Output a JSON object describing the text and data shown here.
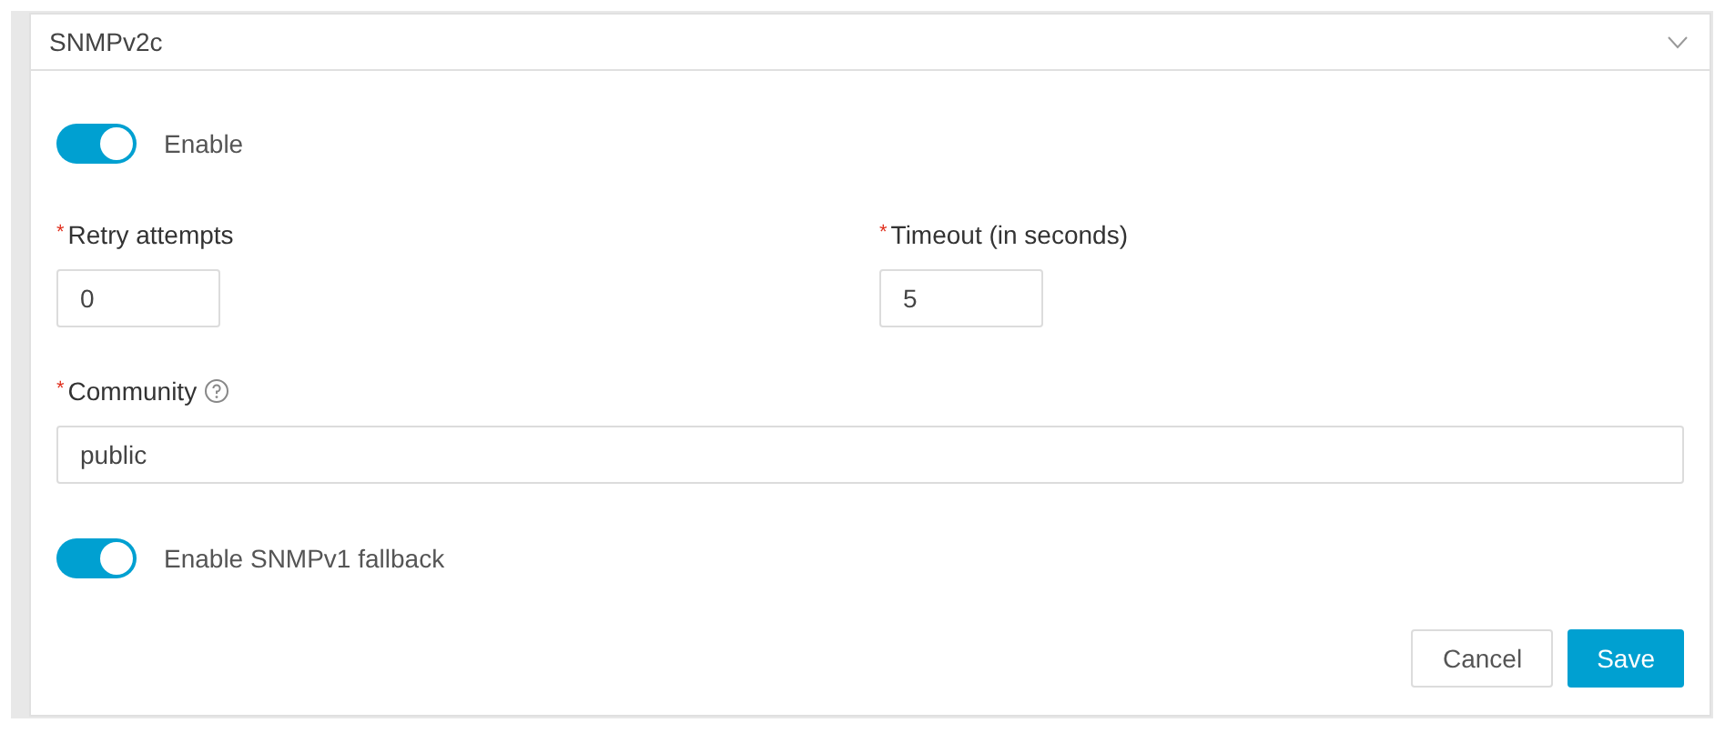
{
  "version_select": {
    "value": "SNMPv2c"
  },
  "enable_toggle": {
    "label": "Enable",
    "on": true
  },
  "fields": [
    {
      "required_mark": "*",
      "label": "Retry attempts",
      "value": "0"
    },
    {
      "required_mark": "*",
      "label": "Timeout (in seconds)",
      "value": "5"
    }
  ],
  "community": {
    "required_mark": "*",
    "label": "Community",
    "value": "public"
  },
  "fallback_toggle": {
    "label": "Enable SNMPv1 fallback",
    "on": true
  },
  "buttons": [
    {
      "label": "Cancel",
      "kind": "secondary"
    },
    {
      "label": "Save",
      "kind": "primary"
    }
  ]
}
